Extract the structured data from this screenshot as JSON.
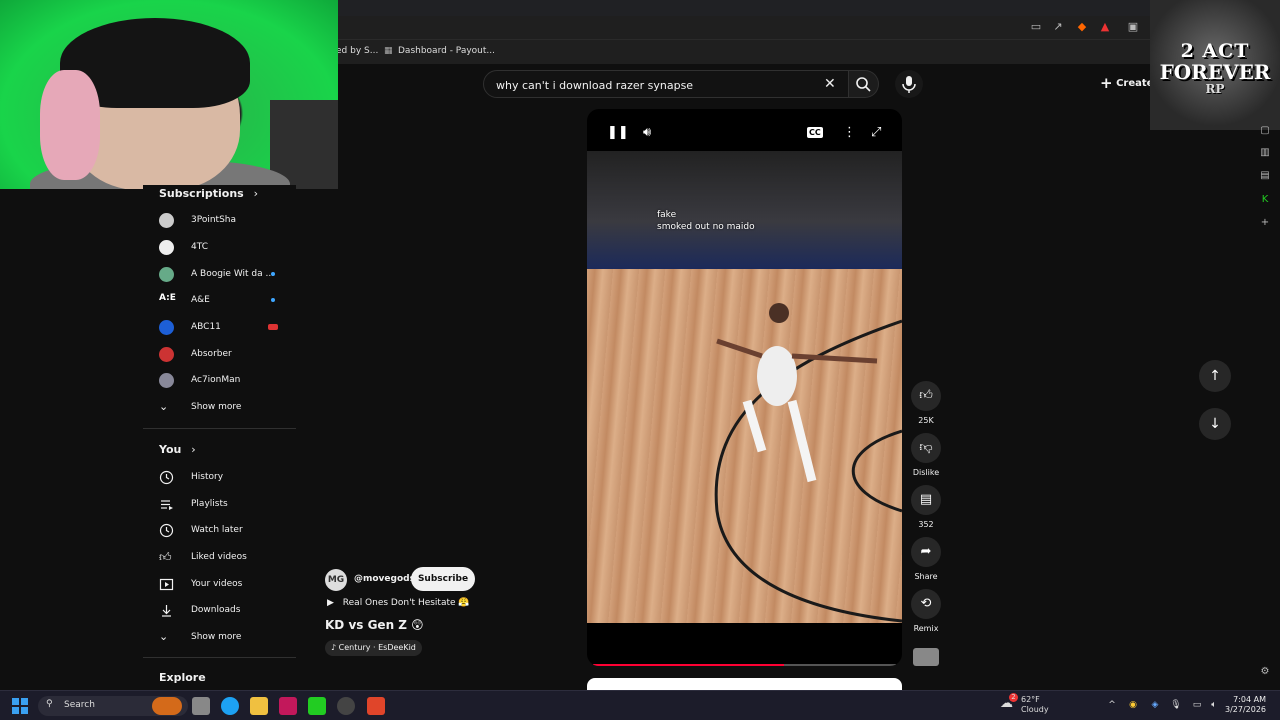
{
  "browser": {
    "bookmarks": [
      {
        "label": "ed by S..."
      },
      {
        "label": "Dashboard - Payout..."
      }
    ]
  },
  "overlay": {
    "logo_line1": "2 ACT",
    "logo_line2": "FOREVER",
    "logo_line3": "RP"
  },
  "search": {
    "query": "why can't i download razer synapse"
  },
  "header": {
    "create_label": "Create"
  },
  "sidebar": {
    "subscriptions_title": "Subscriptions",
    "subscriptions": [
      {
        "label": "3PointSha"
      },
      {
        "label": "4TC"
      },
      {
        "label": "A Boogie Wit da ..."
      },
      {
        "label": "A&E"
      },
      {
        "label": "ABC11"
      },
      {
        "label": "Absorber"
      },
      {
        "label": "Ac7ionMan"
      },
      {
        "label": "Show more"
      }
    ],
    "you_title": "You",
    "you_items": [
      {
        "label": "History"
      },
      {
        "label": "Playlists"
      },
      {
        "label": "Watch later"
      },
      {
        "label": "Liked videos"
      },
      {
        "label": "Your videos"
      },
      {
        "label": "Downloads"
      },
      {
        "label": "Show more"
      }
    ],
    "explore_title": "Explore"
  },
  "video": {
    "caption_line1": "fake",
    "caption_line2": "smoked out no maido",
    "progress": 0.63
  },
  "actions": {
    "likes": "25K",
    "dislike": "Dislike",
    "comments": "352",
    "share": "Share",
    "remix": "Remix"
  },
  "channel": {
    "avatar_text": "MG",
    "handle": "@movegods",
    "subscribe": "Subscribe",
    "playlist": "Real Ones Don't Hesitate 😤",
    "title": "KD vs Gen Z 😲",
    "music": "Century · EsDeeKid"
  },
  "taskbar": {
    "search": "Search",
    "weather_temp": "62°F",
    "weather_desc": "Cloudy",
    "weather_badge": "2",
    "time": "7:04 AM",
    "date": "3/27/2026"
  }
}
